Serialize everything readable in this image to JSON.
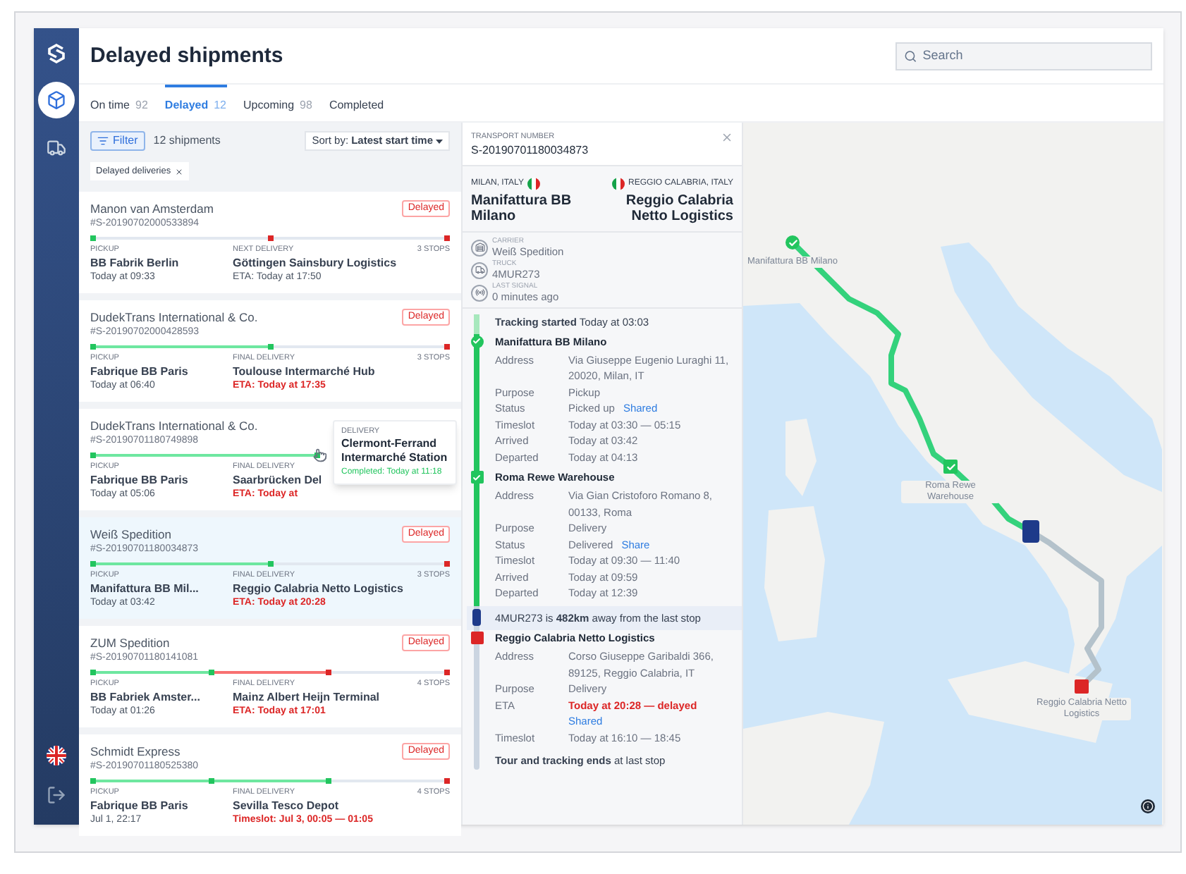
{
  "header": {
    "title": "Delayed shipments",
    "search": {
      "placeholder": "Search"
    }
  },
  "nav": [
    {
      "selected": true
    },
    {
      "selected": false
    }
  ],
  "tabs": [
    {
      "label": "On time",
      "count": "92",
      "selected": false
    },
    {
      "label": "Delayed",
      "count": "12",
      "selected": true
    },
    {
      "label": "Upcoming",
      "count": "98",
      "selected": false
    },
    {
      "label": "Completed",
      "selected": false
    }
  ],
  "list": {
    "filter_button": "Filter",
    "count": "12 shipments",
    "sort_label": "Sort by:",
    "sort_value": "Latest start time",
    "chip": "Delayed deliveries",
    "cards": [
      {
        "carrier": "Manon van Amsterdam",
        "number": "#S-20190702000533894",
        "badge": "Delayed",
        "stops": [
          {
            "reached": true
          },
          {
            "reached": false
          },
          {
            "reached": false
          }
        ],
        "legs": [
          {
            "kind": "pending"
          },
          {
            "kind": "pending"
          }
        ],
        "pickup_label": "PICKUP",
        "pickup": "BB Fabrik Berlin",
        "pickup_time": "Today at 09:33",
        "delivery_label": "NEXT DELIVERY",
        "delivery": "Göttingen Sainsbury Logistics",
        "delivery_time": "ETA: Today at 17:50",
        "delivery_late": false,
        "stops_count": "3 STOPS",
        "selected": false
      },
      {
        "carrier": "DudekTrans International & Co.",
        "number": "#S-20190702000428593",
        "badge": "Delayed",
        "stops": [
          {
            "reached": true
          },
          {
            "reached": true
          },
          {
            "reached": false
          }
        ],
        "legs": [
          {
            "kind": "done"
          },
          {
            "kind": "pending"
          }
        ],
        "pickup_label": "PICKUP",
        "pickup": "Fabrique BB Paris",
        "pickup_time": "Today at 06:40",
        "delivery_label": "FINAL DELIVERY",
        "delivery": "Toulouse Intermarché Hub",
        "delivery_time": "ETA: Today at 17:35",
        "delivery_late": true,
        "stops_count": "3 STOPS",
        "selected": false
      },
      {
        "carrier": "DudekTrans International & Co.",
        "number": "#S-20190701180749898",
        "stops": [
          {
            "reached": true
          },
          {
            "reached": true
          }
        ],
        "legs": [
          {
            "kind": "done"
          }
        ],
        "pickup_label": "PICKUP",
        "pickup": "Fabrique BB Paris",
        "pickup_time": "Today at 05:06",
        "delivery_label": "FINAL DELIVERY",
        "delivery": "Saarbrücken Del",
        "delivery_time": "ETA: Today at",
        "delivery_late": true,
        "selected": false,
        "tooltip": {
          "label": "DELIVERY",
          "title": "Clermont-Ferrand Intermarché Station",
          "status": "Completed: Today at 11:18"
        }
      },
      {
        "carrier": "Weiß Spedition",
        "number": "#S-20190701180034873",
        "badge": "Delayed",
        "stops": [
          {
            "reached": true
          },
          {
            "reached": true
          },
          {
            "reached": false
          }
        ],
        "legs": [
          {
            "kind": "done"
          },
          {
            "kind": "pending"
          }
        ],
        "pickup_label": "PICKUP",
        "pickup": "Manifattura BB Mil...",
        "pickup_time": "Today at 03:42",
        "delivery_label": "FINAL DELIVERY",
        "delivery": "Reggio Calabria Netto Logistics",
        "delivery_time": "ETA: Today at 20:28",
        "delivery_late": true,
        "stops_count": "3 STOPS",
        "selected": true
      },
      {
        "carrier": "ZUM Spedition",
        "number": "#S-20190701180141081",
        "badge": "Delayed",
        "stops": [
          {
            "reached": true
          },
          {
            "reached": true
          },
          {
            "reached": false
          },
          {
            "reached": false
          }
        ],
        "legs": [
          {
            "kind": "done"
          },
          {
            "kind": "late"
          },
          {
            "kind": "pending"
          }
        ],
        "pickup_label": "PICKUP",
        "pickup": "BB Fabriek Amster...",
        "pickup_time": "Today at 01:26",
        "delivery_label": "FINAL DELIVERY",
        "delivery": "Mainz Albert Heijn Terminal",
        "delivery_time": "ETA: Today at 17:01",
        "delivery_late": true,
        "stops_count": "4 STOPS",
        "selected": false
      },
      {
        "carrier": "Schmidt Express",
        "number": "#S-20190701180525380",
        "badge": "Delayed",
        "stops": [
          {
            "reached": true
          },
          {
            "reached": true
          },
          {
            "reached": true
          },
          {
            "reached": false
          }
        ],
        "legs": [
          {
            "kind": "done"
          },
          {
            "kind": "done"
          },
          {
            "kind": "pending"
          }
        ],
        "pickup_label": "PICKUP",
        "pickup": "Fabrique BB Paris",
        "pickup_time": "Jul 1, 22:17",
        "delivery_label": "FINAL DELIVERY",
        "delivery": "Sevilla Tesco Depot",
        "delivery_time": "Timeslot: Jul 3, 00:05 — 01:05",
        "delivery_late": true,
        "stops_count": "4 STOPS",
        "selected": false
      }
    ]
  },
  "detail": {
    "transport_label": "TRANSPORT NUMBER",
    "transport_number": "S-20190701180034873",
    "origin": {
      "region": "MILAN, ITALY",
      "name": "Manifattura BB Milano"
    },
    "destination": {
      "region": "REGGIO CALABRIA, ITALY",
      "name": "Reggio Calabria Netto Logistics"
    },
    "info": [
      {
        "label": "CARRIER",
        "value": "Weiß Spedition"
      },
      {
        "label": "TRUCK",
        "value": "4MUR273"
      },
      {
        "label": "LAST SIGNAL",
        "value": "0 minutes ago"
      }
    ],
    "tracking_start": "**Tracking started** Today at 03:03",
    "stops": [
      {
        "kind": "pickup",
        "done": true,
        "name": "Manifattura BB Milano",
        "rows": [
          {
            "label": "Address",
            "value": "Via Giuseppe Eugenio Luraghi 11, 20020, Milan, IT",
            "alert": false
          },
          {
            "label": "Purpose",
            "value": "Pickup",
            "alert": false
          },
          {
            "label": "Status",
            "value": "Picked up",
            "link": "Shared",
            "alert": false
          },
          {
            "label": "Timeslot",
            "value": "Today at 03:30 — 05:15",
            "alert": false
          },
          {
            "label": "Arrived",
            "value": "Today at 03:42",
            "alert": false
          },
          {
            "label": "Departed",
            "value": "Today at 04:13",
            "alert": false
          }
        ]
      },
      {
        "kind": "delivery",
        "done": true,
        "truck_after": true,
        "name": "Roma Rewe Warehouse",
        "rows": [
          {
            "label": "Address",
            "value": "Via Gian Cristoforo Romano 8, 00133, Roma",
            "alert": false
          },
          {
            "label": "Purpose",
            "value": "Delivery",
            "alert": false
          },
          {
            "label": "Status",
            "value": "Delivered",
            "link": "Share",
            "alert": false
          },
          {
            "label": "Timeslot",
            "value": "Today at 09:30 — 11:40",
            "alert": false
          },
          {
            "label": "Arrived",
            "value": "Today at 09:59",
            "alert": false
          },
          {
            "label": "Departed",
            "value": "Today at 12:39",
            "alert": false
          }
        ]
      },
      {
        "kind": "delivery",
        "done": false,
        "name": "Reggio Calabria Netto Logistics",
        "rows": [
          {
            "label": "Address",
            "value": "Corso Giuseppe Garibaldi 366, 89125, Reggio Calabria, IT",
            "alert": false
          },
          {
            "label": "Purpose",
            "value": "Delivery",
            "alert": false
          },
          {
            "label": "ETA",
            "value": "Today at 20:28 — delayed",
            "link": "Shared",
            "alert": true
          },
          {
            "label": "Timeslot",
            "value": "Today at 16:10 — 18:45",
            "alert": false
          }
        ]
      }
    ],
    "distance": "4MUR273 is **482km** away from the last stop",
    "tracking_end": "**Tour and tracking ends** at last stop"
  },
  "map": {
    "markers": [
      {
        "label": "Manifattura BB Milano",
        "kind": "pickup",
        "done": true
      },
      {
        "label": "Roma Rewe Warehouse",
        "kind": "delivery",
        "done": true
      },
      {
        "label": "Reggio Calabria Netto Logistics",
        "kind": "delivery",
        "done": false
      }
    ]
  }
}
